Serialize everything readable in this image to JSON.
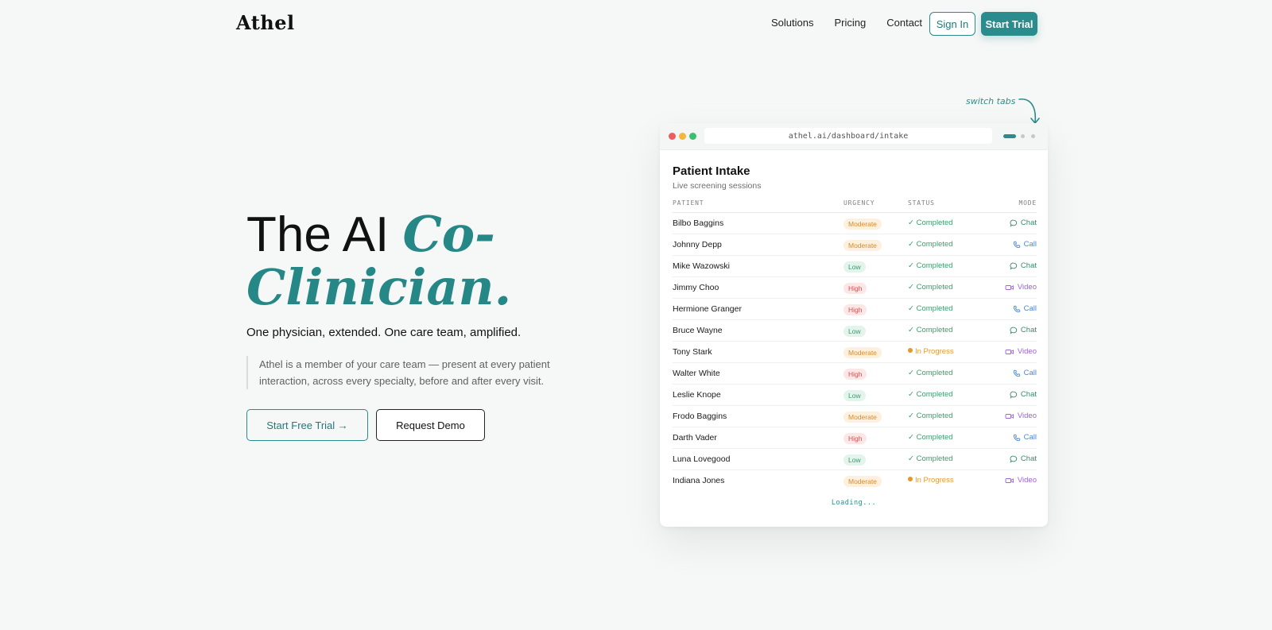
{
  "nav": {
    "logo": "Athel",
    "links": [
      "Solutions",
      "Pricing",
      "Contact"
    ],
    "sign_in": "Sign In",
    "start_trial": "Start Trial"
  },
  "hero": {
    "title_plain": "The AI ",
    "title_accent_1": "Co-",
    "title_accent_2": "Clinician.",
    "subtitle": "One physician, extended. One care team, amplified.",
    "quote": "Athel is a member of your care team — present at every patient interaction, across every specialty, before and after every visit.",
    "cta_primary": "Start Free Trial →",
    "cta_secondary": "Request Demo"
  },
  "hint": {
    "label": "switch tabs"
  },
  "window": {
    "url": "athel.ai/dashboard/intake",
    "title": "Patient Intake",
    "subtitle": "Live screening sessions",
    "headers": {
      "patient": "PATIENT",
      "urgency": "URGENCY",
      "status": "STATUS",
      "mode": "MODE"
    },
    "rows": [
      {
        "name": "Bilbo Baggins",
        "urgency": "Moderate",
        "status": "✓ Completed",
        "mode": "Chat"
      },
      {
        "name": "Johnny Depp",
        "urgency": "Moderate",
        "status": "✓ Completed",
        "mode": "Call"
      },
      {
        "name": "Mike Wazowski",
        "urgency": "Low",
        "status": "✓ Completed",
        "mode": "Chat"
      },
      {
        "name": "Jimmy Choo",
        "urgency": "High",
        "status": "✓ Completed",
        "mode": "Video"
      },
      {
        "name": "Hermione Granger",
        "urgency": "High",
        "status": "✓ Completed",
        "mode": "Call"
      },
      {
        "name": "Bruce Wayne",
        "urgency": "Low",
        "status": "✓ Completed",
        "mode": "Chat"
      },
      {
        "name": "Tony Stark",
        "urgency": "Moderate",
        "status": "In Progress",
        "mode": "Video"
      },
      {
        "name": "Walter White",
        "urgency": "High",
        "status": "✓ Completed",
        "mode": "Call"
      },
      {
        "name": "Leslie Knope",
        "urgency": "Low",
        "status": "✓ Completed",
        "mode": "Chat"
      },
      {
        "name": "Frodo Baggins",
        "urgency": "Moderate",
        "status": "✓ Completed",
        "mode": "Video"
      },
      {
        "name": "Darth Vader",
        "urgency": "High",
        "status": "✓ Completed",
        "mode": "Call"
      },
      {
        "name": "Luna Lovegood",
        "urgency": "Low",
        "status": "✓ Completed",
        "mode": "Chat"
      },
      {
        "name": "Indiana Jones",
        "urgency": "Moderate",
        "status": "In Progress",
        "mode": "Video"
      }
    ],
    "loading": "Loading..."
  },
  "colors": {
    "accent": "#2a8c8c",
    "moderate": "#d98b2b",
    "high": "#d25252",
    "low": "#3c9a6d",
    "completed": "#3aa06c",
    "in_progress": "#e39a2b",
    "chat": "#3a8a6a",
    "call": "#4a86d6",
    "video": "#9b63d8"
  },
  "icons": {
    "chat": "chat-bubble-icon",
    "call": "phone-icon",
    "video": "video-camera-icon"
  }
}
